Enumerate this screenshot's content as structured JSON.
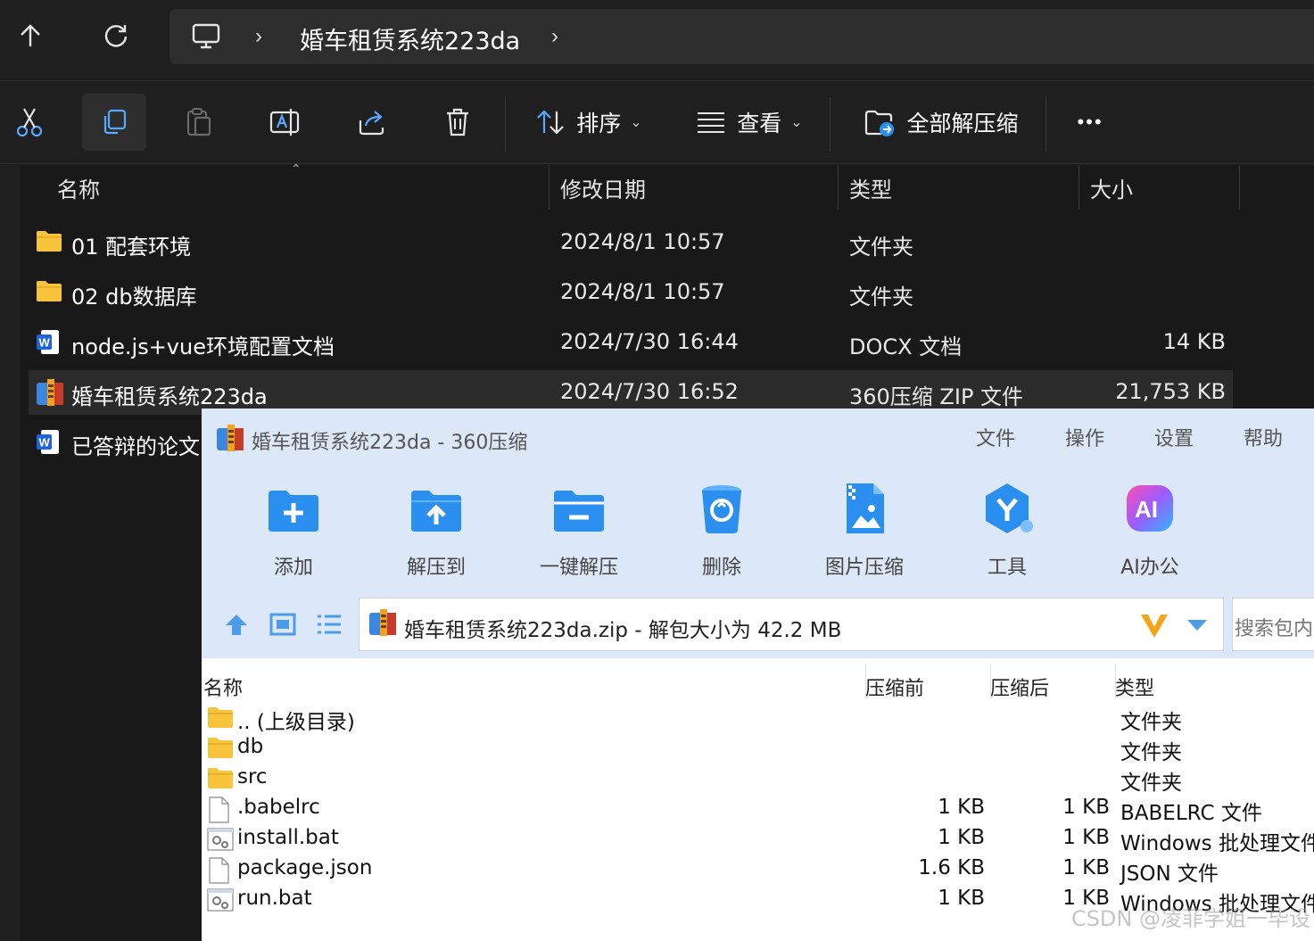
{
  "explorer": {
    "breadcrumb": "婚车租赁系统223da",
    "toolbar": {
      "sort_label": "排序",
      "view_label": "查看",
      "extract_all_label": "全部解压缩",
      "more_label": "•••"
    },
    "columns": {
      "name": "名称",
      "modified": "修改日期",
      "type": "类型",
      "size": "大小"
    },
    "files": [
      {
        "name": "01 配套环境",
        "modified": "2024/8/1 10:57",
        "type": "文件夹",
        "size": "",
        "icon": "folder-icon"
      },
      {
        "name": "02 db数据库",
        "modified": "2024/8/1 10:57",
        "type": "文件夹",
        "size": "",
        "icon": "folder-icon"
      },
      {
        "name": "node.js+vue环境配置文档",
        "modified": "2024/7/30 16:44",
        "type": "DOCX 文档",
        "size": "14 KB",
        "icon": "word-doc-icon"
      },
      {
        "name": "婚车租赁系统223da",
        "modified": "2024/7/30 16:52",
        "type": "360压缩 ZIP 文件",
        "size": "21,753 KB",
        "icon": "zip-archive-icon"
      },
      {
        "name": "已答辩的论文",
        "modified": "",
        "type": "",
        "size": "",
        "icon": "word-doc-icon"
      }
    ]
  },
  "archiver": {
    "title": "婚车租赁系统223da - 360压缩",
    "menu": [
      "文件",
      "操作",
      "设置",
      "帮助"
    ],
    "ribbon": [
      {
        "label": "添加",
        "icon": "add-folder-icon"
      },
      {
        "label": "解压到",
        "icon": "extract-to-icon"
      },
      {
        "label": "一键解压",
        "icon": "one-click-extract-icon"
      },
      {
        "label": "删除",
        "icon": "recycle-bin-icon"
      },
      {
        "label": "图片压缩",
        "icon": "image-compress-icon"
      },
      {
        "label": "工具",
        "icon": "tools-icon"
      },
      {
        "label": "AI办公",
        "icon": "ai-office-icon"
      }
    ],
    "path_text": "婚车租赁系统223da.zip - 解包大小为 42.2 MB",
    "search_placeholder": "搜索包内",
    "columns": {
      "name": "名称",
      "before": "压缩前",
      "after": "压缩后",
      "type": "类型"
    },
    "entries": [
      {
        "name": ".. (上级目录)",
        "before": "",
        "after": "",
        "type": "文件夹",
        "icon": "folder-icon"
      },
      {
        "name": "db",
        "before": "",
        "after": "",
        "type": "文件夹",
        "icon": "folder-icon"
      },
      {
        "name": "src",
        "before": "",
        "after": "",
        "type": "文件夹",
        "icon": "folder-icon"
      },
      {
        "name": ".babelrc",
        "before": "1 KB",
        "after": "1 KB",
        "type": "BABELRC 文件",
        "icon": "blank-file-icon"
      },
      {
        "name": "install.bat",
        "before": "1 KB",
        "after": "1 KB",
        "type": "Windows 批处理文件",
        "icon": "batch-file-icon"
      },
      {
        "name": "package.json",
        "before": "1.6 KB",
        "after": "1 KB",
        "type": "JSON 文件",
        "icon": "blank-file-icon"
      },
      {
        "name": "run.bat",
        "before": "1 KB",
        "after": "1 KB",
        "type": "Windows 批处理文件",
        "icon": "batch-file-icon"
      }
    ]
  },
  "watermark": "CSDN @凌菲学姐一毕设",
  "colors": {
    "accent_blue": "#2b8ff0",
    "folder_yellow": "#f7c43c",
    "dark_bg": "#1c1c1c",
    "zip_bg": "#dce8f7"
  }
}
